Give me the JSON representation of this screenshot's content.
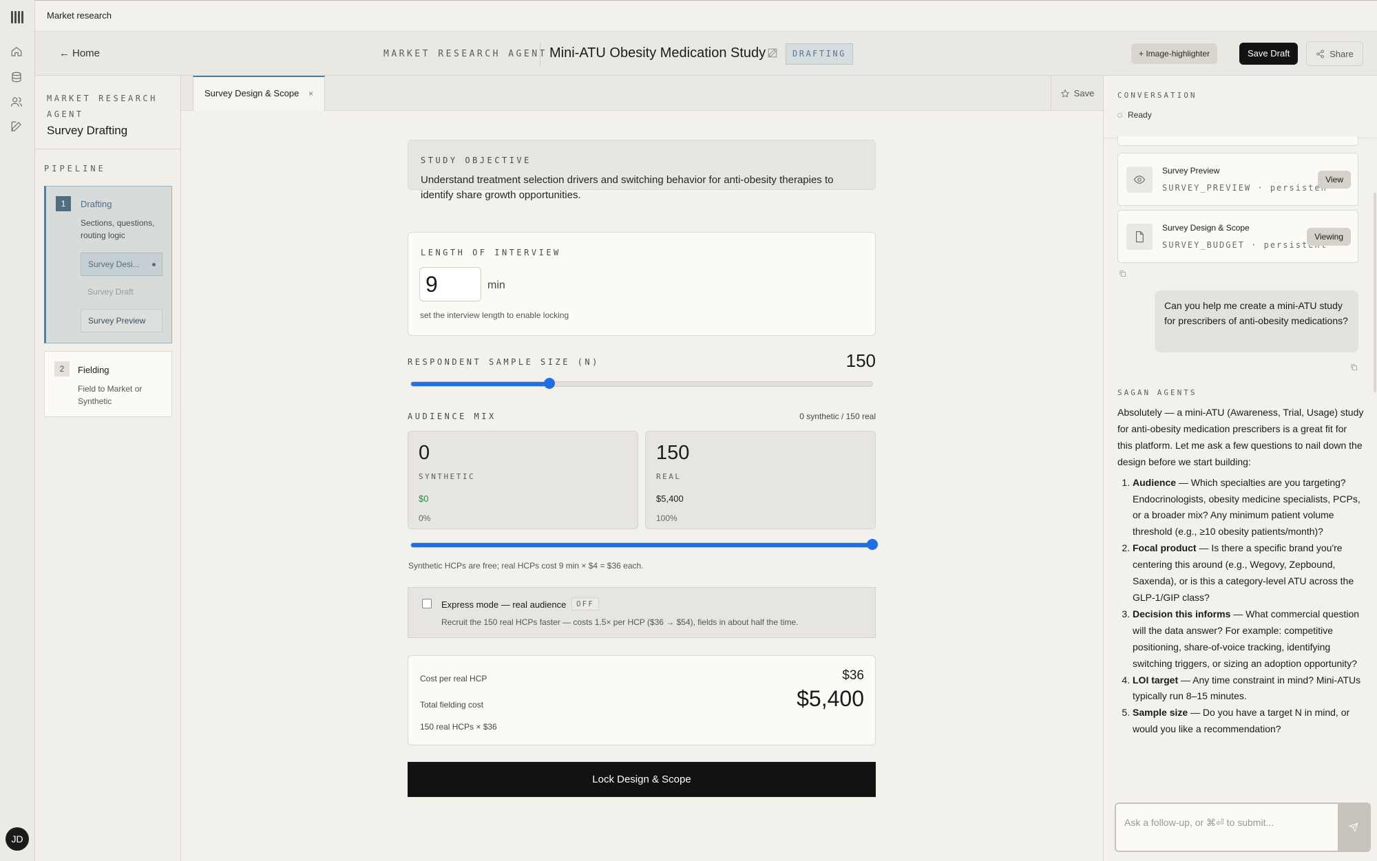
{
  "topbar": {
    "title": "Market research"
  },
  "user": {
    "initials": "JD"
  },
  "header": {
    "home": "Home",
    "agent": "MARKET RESEARCH AGENT",
    "title": "Mini-ATU Obesity Medication Study",
    "status": "DRAFTING",
    "highlighter": "+ Image-highlighter",
    "save_draft": "Save Draft",
    "share": "Share"
  },
  "sidebar": {
    "agent": "MARKET RESEARCH AGENT",
    "title": "Survey Drafting",
    "pipeline": "PIPELINE",
    "stages": [
      {
        "num": "1",
        "title": "Drafting",
        "desc": "Sections, questions, routing logic",
        "items": [
          "Survey Desi...",
          "Survey Draft",
          "Survey Preview"
        ]
      },
      {
        "num": "2",
        "title": "Fielding",
        "desc": "Field to Market or Synthetic"
      }
    ]
  },
  "tabs": {
    "active": "Survey Design & Scope",
    "close": "×",
    "save": "Save"
  },
  "main": {
    "objective": {
      "label": "STUDY OBJECTIVE",
      "text": "Understand treatment selection drivers and switching behavior for anti-obesity therapies to identify share growth opportunities."
    },
    "loi": {
      "label": "LENGTH OF INTERVIEW",
      "value": "9",
      "unit": "min",
      "hint": "set the interview length to enable locking"
    },
    "sample": {
      "label": "RESPONDENT SAMPLE SIZE (N)",
      "value": "150",
      "fraction": 0.3
    },
    "mix": {
      "label": "AUDIENCE MIX",
      "summary": "0 synthetic / 150 real",
      "synthetic": {
        "num": "0",
        "kind": "SYNTHETIC",
        "cost": "$0",
        "pct": "0%"
      },
      "real": {
        "num": "150",
        "kind": "REAL",
        "cost": "$5,400",
        "pct": "100%"
      },
      "real_fraction": 1.0,
      "note": "Synthetic HCPs are free; real HCPs cost 9 min × $4 = $36 each."
    },
    "express": {
      "title": "Express mode — real audience",
      "state": "OFF",
      "desc": "Recruit the 150 real HCPs faster — costs 1.5× per HCP ($36 → $54), fields in about half the time."
    },
    "cost": {
      "per_label": "Cost per real HCP",
      "per_value": "$36",
      "total_label": "Total fielding cost",
      "total_value": "$5,400",
      "formula": "150 real HCPs × $36"
    },
    "lock": "Lock Design & Scope"
  },
  "conversation": {
    "label": "CONVERSATION",
    "status": "Ready",
    "artifacts": [
      {
        "title": "Survey Preview",
        "sub": "SURVEY_PREVIEW · persistent",
        "action": "View"
      },
      {
        "title": "Survey Design & Scope",
        "sub": "SURVEY_BUDGET · persistent",
        "action": "Viewing"
      }
    ],
    "user_message": "Can you help me create a mini-ATU study for prescribers of anti-obesity medications?",
    "agents_label": "SAGAN AGENTS",
    "reply_intro": "Absolutely — a mini-ATU (Awareness, Trial, Usage) study for anti-obesity medication prescribers is a great fit for this platform. Let me ask a few questions to nail down the design before we start building:",
    "reply_items": [
      {
        "head": "Audience",
        "body": " — Which specialties are you targeting? Endocrinologists, obesity medicine specialists, PCPs, or a broader mix? Any minimum patient volume threshold (e.g., ≥10 obesity patients/month)?"
      },
      {
        "head": "Focal product",
        "body": " — Is there a specific brand you're centering this around (e.g., Wegovy, Zepbound, Saxenda), or is this a category-level ATU across the GLP-1/GIP class?"
      },
      {
        "head": "Decision this informs",
        "body": " — What commercial question will the data answer? For example: competitive positioning, share-of-voice tracking, identifying switching triggers, or sizing an adoption opportunity?"
      },
      {
        "head": "LOI target",
        "body": " — Any time constraint in mind? Mini-ATUs typically run 8–15 minutes."
      },
      {
        "head": "Sample size",
        "body": " — Do you have a target N in mind, or would you like a recommendation?"
      }
    ],
    "composer_placeholder": "Ask a follow-up, or ⌘⏎ to submit..."
  }
}
